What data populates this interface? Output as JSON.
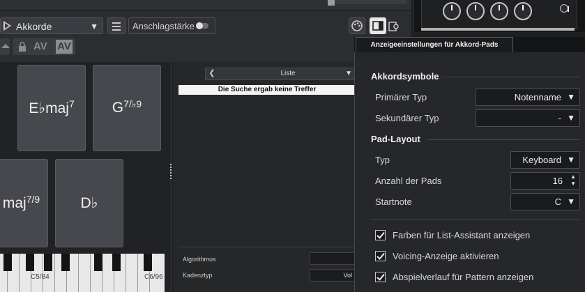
{
  "toolbar": {
    "chord_dropdown": "Akkorde",
    "velocity_label": "Anschlagstärke",
    "av_label_1": "AV",
    "av_label_2": "AV"
  },
  "pads": [
    {
      "root": "E♭maj",
      "ext": "7"
    },
    {
      "root": "G",
      "ext": "7/♭9"
    },
    {
      "root": "maj",
      "ext": "7/9"
    },
    {
      "root": "D♭",
      "ext": ""
    }
  ],
  "keyboard": {
    "labels": [
      "C5/84",
      "C6/96"
    ]
  },
  "assistant": {
    "list_mode": "Liste",
    "no_results": "Die Suche ergab keine Treffer",
    "algorithm_label": "Algorithmus",
    "cadence_label": "Kadenztyp",
    "cadence_value": "Vol"
  },
  "settings": {
    "tab_title": "Anzeigeeinstellungen für Akkord-Pads",
    "chord_symbols_header": "Akkordsymbole",
    "primary_type_label": "Primärer Typ",
    "primary_type_value": "Notenname",
    "secondary_type_label": "Sekundärer Typ",
    "secondary_type_value": "-",
    "pad_layout_header": "Pad-Layout",
    "layout_type_label": "Typ",
    "layout_type_value": "Keyboard",
    "pad_count_label": "Anzahl der Pads",
    "pad_count_value": "16",
    "start_note_label": "Startnote",
    "start_note_value": "C",
    "options": [
      {
        "label": "Farben für List-Assistant anzeigen",
        "checked": true
      },
      {
        "label": "Voicing-Anzeige aktivieren",
        "checked": true
      },
      {
        "label": "Abspielverlauf für Pattern anzeigen",
        "checked": true
      }
    ]
  }
}
